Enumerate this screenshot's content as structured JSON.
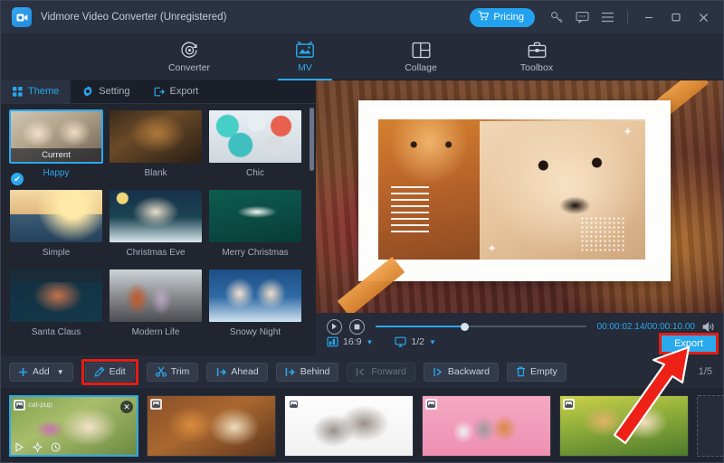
{
  "window": {
    "title": "Vidmore Video Converter (Unregistered)",
    "logo_icon": "video-camera-icon",
    "pricing_label": "Pricing",
    "pricing_icon": "cart-icon",
    "key_icon": "key-icon",
    "feedback_icon": "feedback-icon",
    "menu_icon": "hamburger-menu-icon",
    "minimize_icon": "minimize-icon",
    "maximize_icon": "maximize-icon",
    "close_icon": "close-icon",
    "accent_color": "#29a9ee",
    "highlight_color": "#e21d16"
  },
  "mainnav": {
    "items": [
      {
        "label": "Converter",
        "icon": "converter-icon",
        "active": false
      },
      {
        "label": "MV",
        "icon": "mv-icon",
        "active": true
      },
      {
        "label": "Collage",
        "icon": "collage-icon",
        "active": false
      },
      {
        "label": "Toolbox",
        "icon": "toolbox-icon",
        "active": false
      }
    ]
  },
  "panel_tabs": [
    {
      "label": "Theme",
      "icon": "grid-icon",
      "active": true
    },
    {
      "label": "Setting",
      "icon": "gear-icon",
      "active": false
    },
    {
      "label": "Export",
      "icon": "export-icon",
      "active": false
    }
  ],
  "themes": [
    {
      "name": "Happy",
      "selected": true,
      "badge": "Current",
      "img": "im-happy"
    },
    {
      "name": "Blank",
      "selected": false,
      "badge": "",
      "img": "im-blank"
    },
    {
      "name": "Chic",
      "selected": false,
      "badge": "",
      "img": "im-chic"
    },
    {
      "name": "Simple",
      "selected": false,
      "badge": "",
      "img": "im-simple"
    },
    {
      "name": "Christmas Eve",
      "selected": false,
      "badge": "",
      "img": "im-xmas-eve"
    },
    {
      "name": "Merry Christmas",
      "selected": false,
      "badge": "",
      "img": "im-merry"
    },
    {
      "name": "Santa Claus",
      "selected": false,
      "badge": "",
      "img": "im-santa"
    },
    {
      "name": "Modern Life",
      "selected": false,
      "badge": "",
      "img": "im-modern"
    },
    {
      "name": "Snowy Night",
      "selected": false,
      "badge": "",
      "img": "im-snowy"
    }
  ],
  "player": {
    "play_icon": "play-icon",
    "stop_icon": "stop-icon",
    "current_time": "00:00:02.14",
    "total_time": "00:00:10.00",
    "time_display": "00:00:02.14/00:00:10.00",
    "progress_percent": 42,
    "volume_icon": "volume-icon",
    "aspect_ratio": "16:9",
    "aspect_icon": "aspect-ratio-icon",
    "scale": "1/2",
    "scale_icon": "monitor-icon",
    "export_label": "Export"
  },
  "actions": [
    {
      "label": "Add",
      "icon": "plus-icon",
      "dropdown": true,
      "disabled": false,
      "highlighted": false
    },
    {
      "label": "Edit",
      "icon": "edit-icon",
      "dropdown": false,
      "disabled": false,
      "highlighted": true
    },
    {
      "label": "Trim",
      "icon": "scissors-icon",
      "dropdown": false,
      "disabled": false,
      "highlighted": false
    },
    {
      "label": "Ahead",
      "icon": "insert-ahead-icon",
      "dropdown": false,
      "disabled": false,
      "highlighted": false
    },
    {
      "label": "Behind",
      "icon": "insert-behind-icon",
      "dropdown": false,
      "disabled": false,
      "highlighted": false
    },
    {
      "label": "Forward",
      "icon": "move-forward-icon",
      "dropdown": false,
      "disabled": true,
      "highlighted": false
    },
    {
      "label": "Backward",
      "icon": "move-backward-icon",
      "dropdown": false,
      "disabled": false,
      "highlighted": false
    },
    {
      "label": "Empty",
      "icon": "trash-icon",
      "dropdown": false,
      "disabled": false,
      "highlighted": false
    }
  ],
  "page_indicator": "1/5",
  "clips": [
    {
      "name": "cat-pup",
      "selected": true,
      "img": "cl-1",
      "badge_icon": "image-icon",
      "close_icon": "close-icon",
      "tools": [
        "play-icon",
        "effect-icon",
        "duration-icon"
      ]
    },
    {
      "name": "",
      "selected": false,
      "img": "cl-2",
      "badge_icon": "image-icon"
    },
    {
      "name": "",
      "selected": false,
      "img": "cl-3",
      "badge_icon": "image-icon"
    },
    {
      "name": "",
      "selected": false,
      "img": "cl-4",
      "badge_icon": "image-icon"
    },
    {
      "name": "",
      "selected": false,
      "img": "cl-5",
      "badge_icon": "image-icon"
    }
  ],
  "add_slot": {
    "icon": "plus-icon",
    "label": "+"
  },
  "annotations": {
    "arrow_icon": "red-arrow-pointing-to-export",
    "edit_highlight": "red-rectangle-around-edit",
    "export_highlight": "red-rectangle-around-export"
  }
}
